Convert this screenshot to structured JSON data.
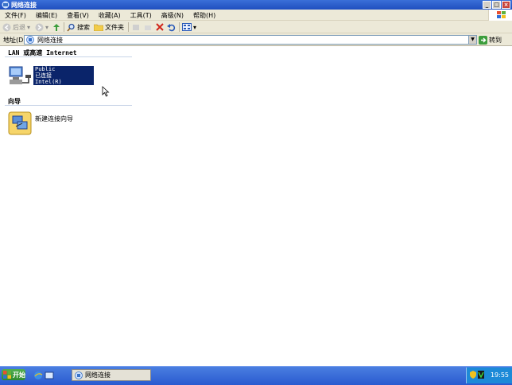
{
  "window": {
    "title": "网络连接",
    "controls": [
      "_",
      "□",
      "×"
    ]
  },
  "menu": [
    "文件(F)",
    "编辑(E)",
    "查看(V)",
    "收藏(A)",
    "工具(T)",
    "高级(N)",
    "帮助(H)"
  ],
  "toolbar": {
    "back": "后退",
    "search": "搜索",
    "folders": "文件夹"
  },
  "address": {
    "label": "地址(D)",
    "value": "网络连接",
    "go": "转到"
  },
  "groups": {
    "lan": "LAN 或高速 Internet",
    "wizard": "向导"
  },
  "connection": {
    "name": "Public",
    "status": "已连接",
    "device": "Intel(R) PRO/100..."
  },
  "wizard_item": "新建连接向导",
  "taskbar": {
    "start": "开始",
    "task": "网络连接",
    "clock": "19:55"
  },
  "colors": {
    "titlebar": "#1f4fbf",
    "selection": "#0a246a",
    "taskbar": "#2a5ad0",
    "tray": "#1d8ad8"
  }
}
